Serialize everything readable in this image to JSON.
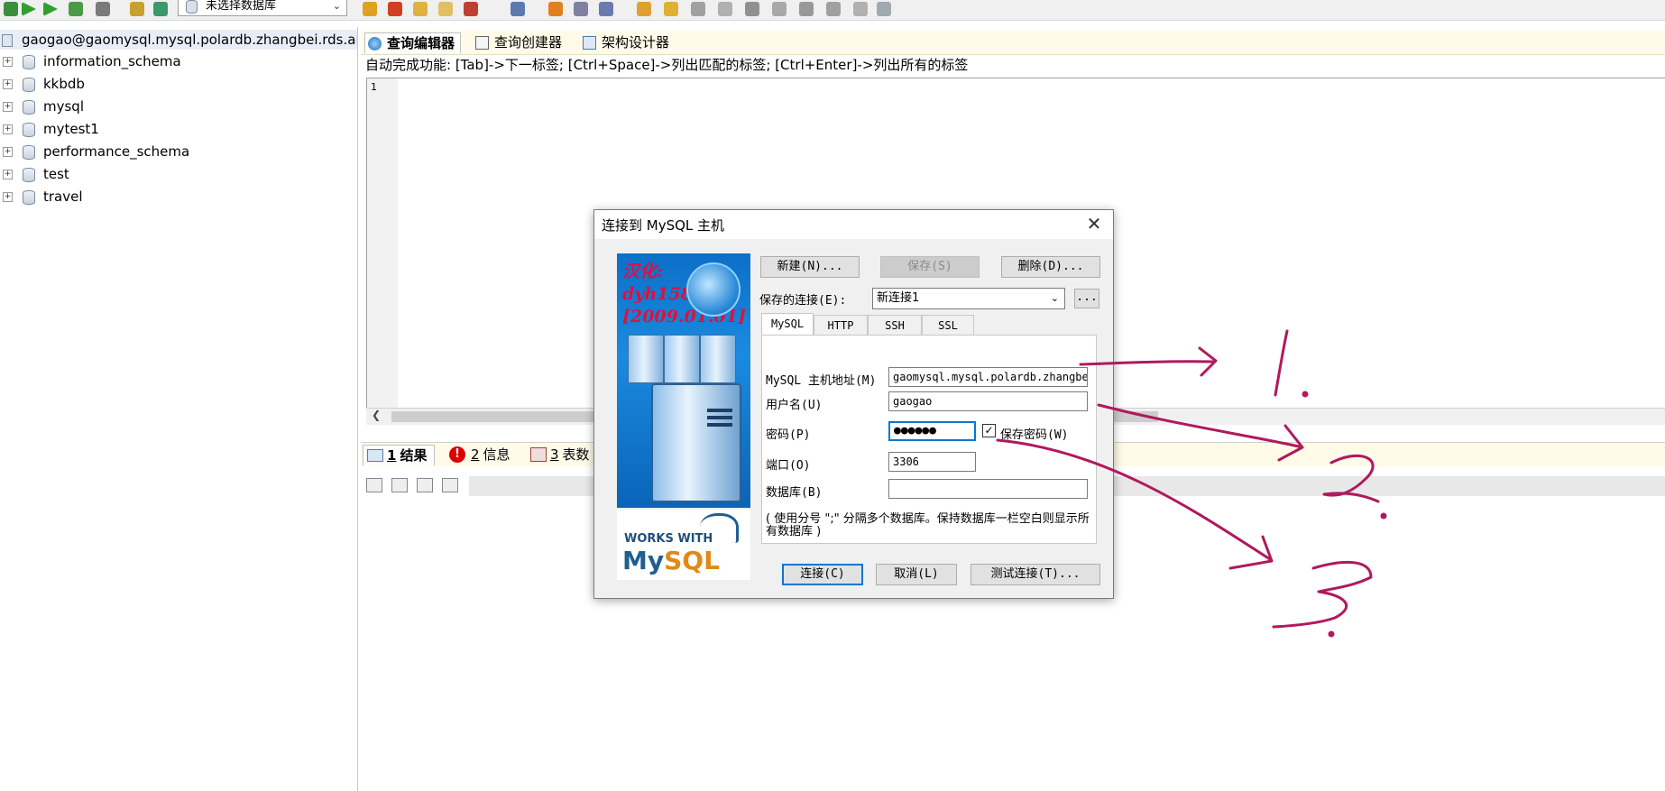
{
  "toolbar": {
    "db_select_value": "未选择数据库"
  },
  "tree": {
    "root": "gaogao@gaomysql.mysql.polardb.zhangbei.rds.al",
    "databases": [
      "information_schema",
      "kkbdb",
      "mysql",
      "mytest1",
      "performance_schema",
      "test",
      "travel"
    ]
  },
  "editor": {
    "tabs": [
      "查询编辑器",
      "查询创建器",
      "架构设计器"
    ],
    "hint": "自动完成功能: [Tab]->下一标签; [Ctrl+Space]->列出匹配的标签; [Ctrl+Enter]->列出所有的标签",
    "line_number": "1"
  },
  "results": {
    "tabs": [
      {
        "num": "1",
        "label": "结果"
      },
      {
        "num": "2",
        "label": "信息"
      },
      {
        "num": "3",
        "label": "表数"
      }
    ]
  },
  "dialog": {
    "title": "连接到 MySQL 主机",
    "credit": "汉化:\ndyh158\n[2009.01.01]",
    "logo_works_with": "WORKS WITH",
    "logo_my": "My",
    "logo_sql": "SQL",
    "buttons": {
      "new": "新建(N)...",
      "save": "保存(S)",
      "delete": "删除(D)...",
      "more": "...",
      "connect": "连接(C)",
      "cancel": "取消(L)",
      "test": "测试连接(T)..."
    },
    "saved_connection_label": "保存的连接(E):",
    "saved_connection_value": "新连接1",
    "tabs": [
      "MySQL",
      "HTTP",
      "SSH",
      "SSL"
    ],
    "fields": {
      "host_label": "MySQL 主机地址(M)",
      "host_value": "gaomysql.mysql.polardb.zhangbei.rds.aliyuncs.com",
      "user_label": "用户名(U)",
      "user_value": "gaogao",
      "password_label": "密码(P)",
      "password_value": "●●●●●●",
      "save_password_label": "保存密码(W)",
      "port_label": "端口(O)",
      "port_value": "3306",
      "database_label": "数据库(B)",
      "database_value": ""
    },
    "note": "( 使用分号 \";\" 分隔多个数据库。保持数据库一栏空白则显示所有数据库 )"
  },
  "annotations": [
    "1.",
    "2.",
    "3."
  ]
}
